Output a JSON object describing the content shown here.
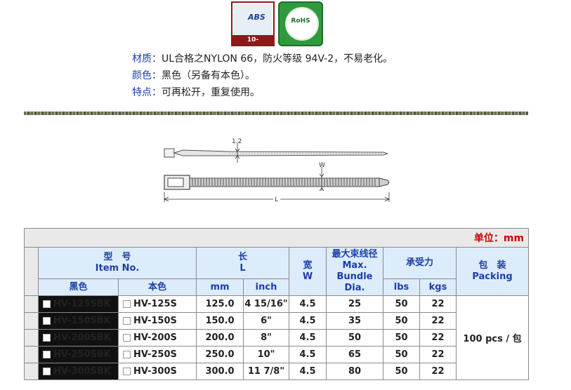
{
  "logos": {
    "abs_word": "ABS",
    "abs_cert": "10-TWI537024",
    "rohs": "RoHS"
  },
  "description": [
    {
      "label": "材质：",
      "value": "UL合格之NYLON 66，防火等级 94V-2，不易老化。"
    },
    {
      "label": "颜色：",
      "value": "黑色（另备有本色）。"
    },
    {
      "label": "特点：",
      "value": "可再松开，重复使用。"
    }
  ],
  "diagram": {
    "thickness_label": "1.2",
    "width_label": "W",
    "length_label": "L"
  },
  "table": {
    "unit": "单位：mm",
    "headers": {
      "model": "型　号",
      "model_en": "Item No.",
      "length": "长",
      "length_en": "L",
      "width": "宽",
      "width_en": "W",
      "bundle": "最大束线径",
      "bundle_en1": "Max.",
      "bundle_en2": "Bundle",
      "bundle_en3": "Dia.",
      "tensile": "承受力",
      "packing": "包　装",
      "packing_en": "Packing",
      "black": "黑色",
      "natural": "本色",
      "mm": "mm",
      "inch": "inch",
      "lbs": "lbs",
      "kgs": "kgs"
    },
    "rows": [
      {
        "black": "HV-125SBK",
        "natural": "HV-125S",
        "mm": "125.0",
        "inch": "4 15/16\"",
        "w": "4.5",
        "dia": "25",
        "lbs": "50",
        "kgs": "22"
      },
      {
        "black": "HV-150SBK",
        "natural": "HV-150S",
        "mm": "150.0",
        "inch": "6\"",
        "w": "4.5",
        "dia": "35",
        "lbs": "50",
        "kgs": "22"
      },
      {
        "black": "HV-200SBK",
        "natural": "HV-200S",
        "mm": "200.0",
        "inch": "8\"",
        "w": "4.5",
        "dia": "50",
        "lbs": "50",
        "kgs": "22"
      },
      {
        "black": "HV-250SBK",
        "natural": "HV-250S",
        "mm": "250.0",
        "inch": "10\"",
        "w": "4.5",
        "dia": "65",
        "lbs": "50",
        "kgs": "22"
      },
      {
        "black": "HV-300SBK",
        "natural": "HV-300S",
        "mm": "300.0",
        "inch": "11 7/8\"",
        "w": "4.5",
        "dia": "80",
        "lbs": "50",
        "kgs": "22"
      }
    ],
    "packing_value": "100 pcs / 包"
  },
  "colors": {
    "label_blue": "#1c3fa8",
    "header_bg": "#dcecfa",
    "unit_red": "#cc0000",
    "black_cell": "#111111"
  }
}
